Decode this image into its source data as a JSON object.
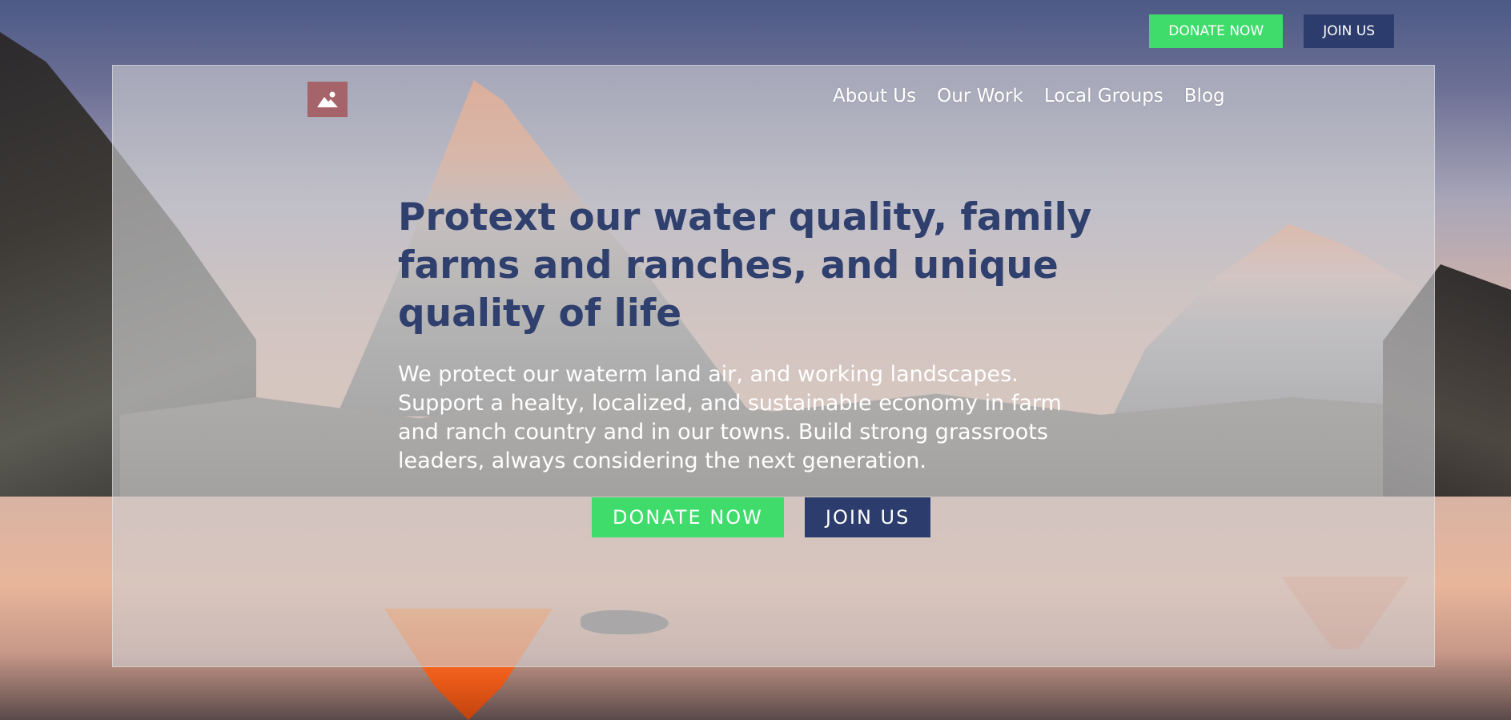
{
  "top_bar": {
    "donate_label": "DONATE NOW",
    "join_label": "JOIN US"
  },
  "nav": {
    "items": [
      "About Us",
      "Our Work",
      "Local Groups",
      "Blog"
    ]
  },
  "hero": {
    "headline": "Protext our water quality, family farms and ranches, and unique quality of life",
    "body": "We protect our waterm land air, and working landscapes. Support a healty, localized, and sustainable economy in farm and ranch country and in our towns. Build strong grassroots leaders, always considering the next generation.",
    "donate_label": "DONATE NOW",
    "join_label": "JOIN US"
  },
  "icons": {
    "logo": "mountain-image-icon"
  },
  "colors": {
    "green": "#3fdc6b",
    "navy": "#2c3c6c",
    "headline": "#2f3f6e",
    "logo_bg": "#a5636a"
  }
}
